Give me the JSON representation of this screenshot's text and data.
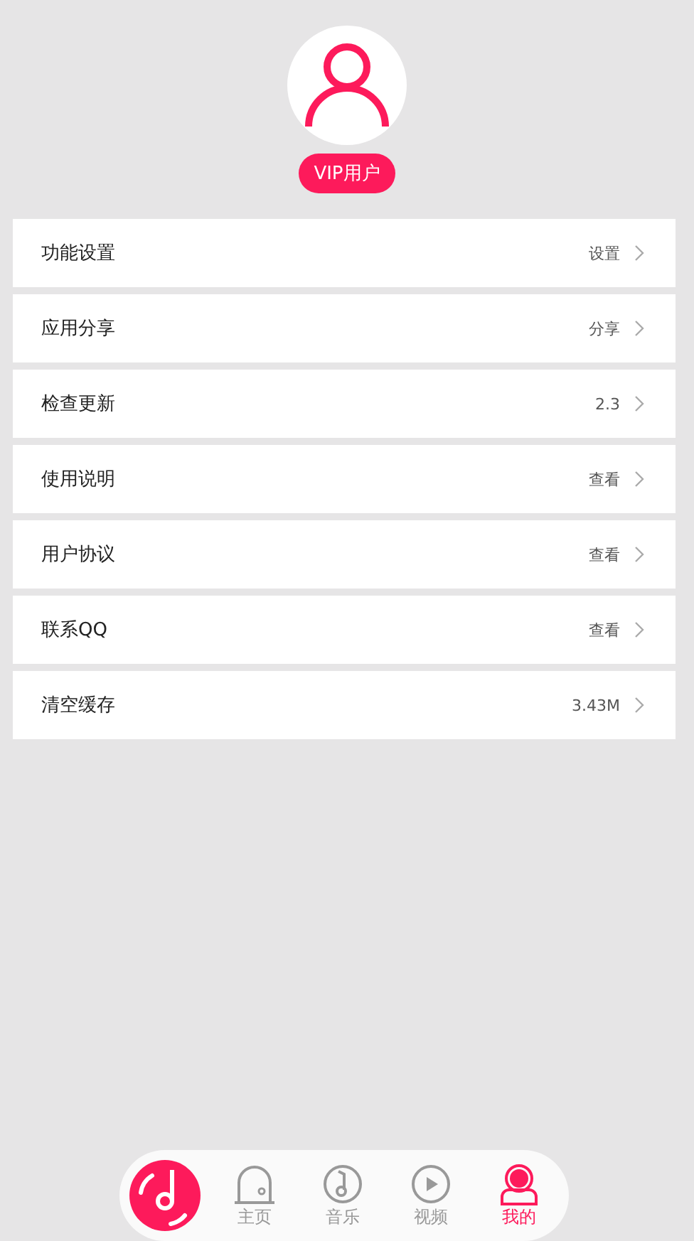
{
  "profile": {
    "badge": "VIP用户"
  },
  "menu": [
    {
      "label": "功能设置",
      "value": "设置"
    },
    {
      "label": "应用分享",
      "value": "分享"
    },
    {
      "label": "检查更新",
      "value": "2.3"
    },
    {
      "label": "使用说明",
      "value": "查看"
    },
    {
      "label": "用户协议",
      "value": "查看"
    },
    {
      "label": "联系QQ",
      "value": "查看"
    },
    {
      "label": "清空缓存",
      "value": "3.43M"
    }
  ],
  "tabs": [
    {
      "kind": "home",
      "label": "主页",
      "selected": false
    },
    {
      "kind": "music",
      "label": "音乐",
      "selected": false
    },
    {
      "kind": "video",
      "label": "视频",
      "selected": false
    },
    {
      "kind": "me",
      "label": "我的",
      "selected": true
    }
  ]
}
